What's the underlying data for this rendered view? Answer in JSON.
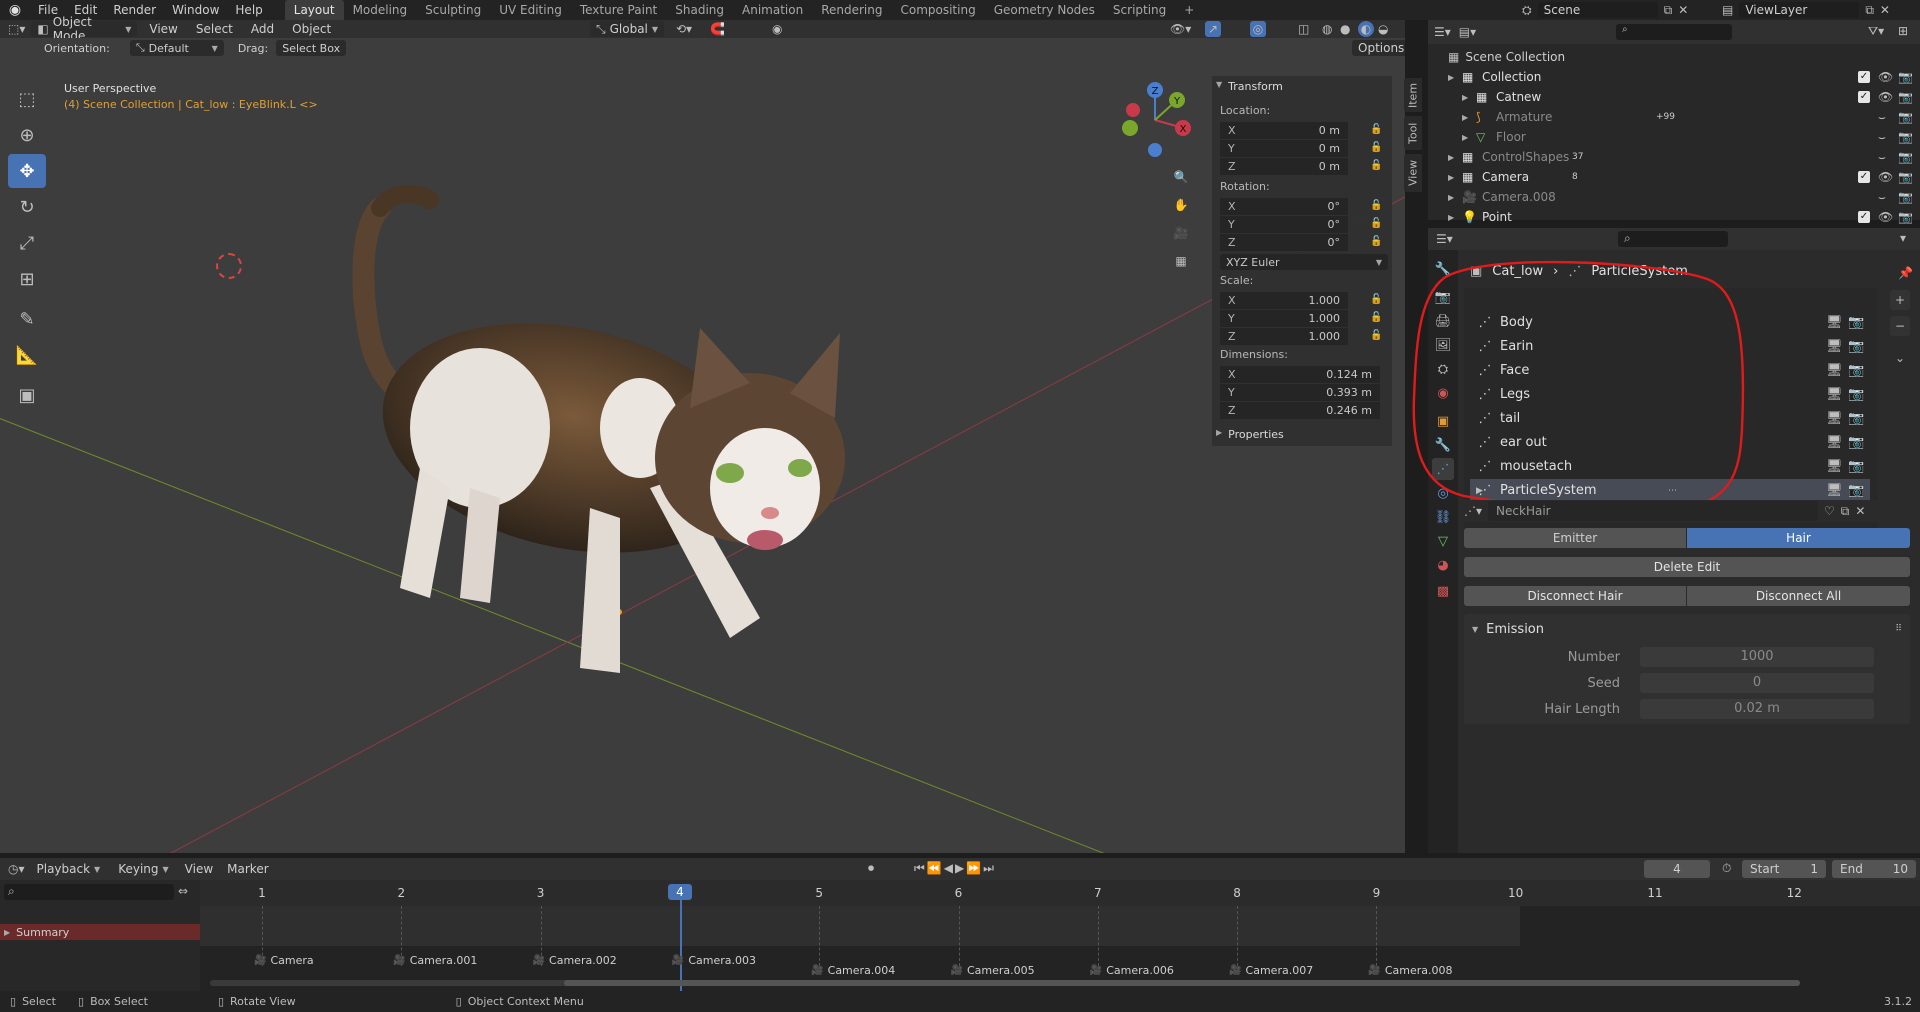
{
  "topbar": {
    "menus": [
      "File",
      "Edit",
      "Render",
      "Window",
      "Help"
    ],
    "workspaces": [
      "Layout",
      "Modeling",
      "Sculpting",
      "UV Editing",
      "Texture Paint",
      "Shading",
      "Animation",
      "Rendering",
      "Compositing",
      "Geometry Nodes",
      "Scripting"
    ],
    "add_tab": "+",
    "scene": "Scene",
    "viewlayer": "ViewLayer"
  },
  "header": {
    "mode": "Object Mode",
    "menus": [
      "View",
      "Select",
      "Add",
      "Object"
    ],
    "transform_orientation": "Global",
    "orientation_label": "Orientation:",
    "orientation_value": "Default",
    "drag_label": "Drag:",
    "drag_value": "Select Box",
    "options": "Options"
  },
  "viewport": {
    "title": "User Perspective",
    "subtitle": "(4) Scene Collection | Cat_low : EyeBlink.L <>",
    "axis_x": "X",
    "axis_y": "Y",
    "axis_z": "Z"
  },
  "npanel": {
    "title": "Transform",
    "location_label": "Location:",
    "rotation_label": "Rotation:",
    "scale_label": "Scale:",
    "dimensions_label": "Dimensions:",
    "location": [
      {
        "a": "X",
        "v": "0 m"
      },
      {
        "a": "Y",
        "v": "0 m"
      },
      {
        "a": "Z",
        "v": "0 m"
      }
    ],
    "rotation": [
      {
        "a": "X",
        "v": "0°"
      },
      {
        "a": "Y",
        "v": "0°"
      },
      {
        "a": "Z",
        "v": "0°"
      }
    ],
    "rotation_mode": "XYZ Euler",
    "scale": [
      {
        "a": "X",
        "v": "1.000"
      },
      {
        "a": "Y",
        "v": "1.000"
      },
      {
        "a": "Z",
        "v": "1.000"
      }
    ],
    "dimensions": [
      {
        "a": "X",
        "v": "0.124 m"
      },
      {
        "a": "Y",
        "v": "0.393 m"
      },
      {
        "a": "Z",
        "v": "0.246 m"
      }
    ],
    "properties": "Properties",
    "tabs": [
      "Item",
      "Tool",
      "View"
    ]
  },
  "outliner": {
    "root": "Scene Collection",
    "rows": [
      {
        "label": "Collection",
        "indent": 1,
        "icon": "collection-icon",
        "dim": false
      },
      {
        "label": "Catnew",
        "indent": 2,
        "icon": "collection-icon",
        "dim": false
      },
      {
        "label": "Armature",
        "indent": 2,
        "icon": "armature-icon",
        "dim": true,
        "extra": "+99"
      },
      {
        "label": "Floor",
        "indent": 2,
        "icon": "mesh-icon",
        "dim": true
      },
      {
        "label": "ControlShapes",
        "indent": 1,
        "icon": "collection-icon",
        "dim": true,
        "count": "37"
      },
      {
        "label": "Camera",
        "indent": 1,
        "icon": "collection-icon",
        "dim": false,
        "count": "8"
      },
      {
        "label": "Camera.008",
        "indent": 1,
        "icon": "camera-icon",
        "dim": true
      },
      {
        "label": "Point",
        "indent": 1,
        "icon": "light-icon",
        "dim": false
      }
    ]
  },
  "properties": {
    "object": "Cat_low",
    "context": "ParticleSystem",
    "systems": [
      "Body",
      "Earin",
      "Face",
      "Legs",
      "tail",
      "ear out",
      "mousetach",
      "ParticleSystem"
    ],
    "selected_system": "ParticleSystem",
    "settings_name": "NeckHair",
    "type_emitter": "Emitter",
    "type_hair": "Hair",
    "delete_edit": "Delete Edit",
    "disconnect_hair": "Disconnect Hair",
    "disconnect_all": "Disconnect All",
    "emission": "Emission",
    "number_label": "Number",
    "number_value": "1000",
    "seed_label": "Seed",
    "seed_value": "0",
    "hairlen_label": "Hair Length",
    "hairlen_value": "0.02 m"
  },
  "timeline": {
    "menus": [
      "Playback",
      "Keying",
      "View",
      "Marker"
    ],
    "current_frame": "4",
    "start_label": "Start",
    "start": "1",
    "end_label": "End",
    "end": "10",
    "summary": "Summary",
    "ticks": [
      "1",
      "2",
      "3",
      "4",
      "5",
      "6",
      "7",
      "8",
      "9",
      "10",
      "11",
      "12"
    ],
    "cameras": [
      "Camera",
      "Camera.001",
      "Camera.002",
      "Camera.003",
      "Camera.004",
      "Camera.005",
      "Camera.006",
      "Camera.007",
      "Camera.008"
    ]
  },
  "statusbar": {
    "select": "Select",
    "box_select": "Box Select",
    "rotate_view": "Rotate View",
    "context_menu": "Object Context Menu",
    "version": "3.1.2"
  },
  "colors": {
    "accent": "#4772b3",
    "annotation": "#e01b1b",
    "x_axis": "#c83a4a",
    "y_axis": "#7aa62c"
  }
}
